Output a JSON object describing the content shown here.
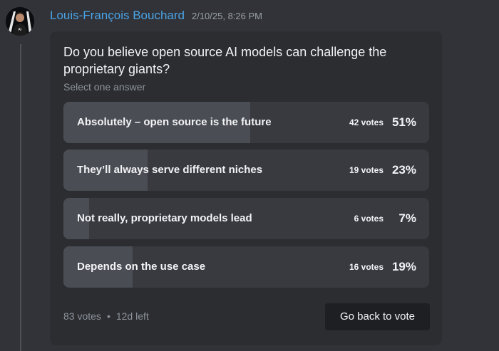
{
  "message": {
    "author": "Louis-François Bouchard",
    "timestamp": "2/10/25, 8:26 PM"
  },
  "poll": {
    "question": "Do you believe open source AI models can challenge the proprietary giants?",
    "hint": "Select one answer",
    "options": [
      {
        "label": "Absolutely – open source is the future",
        "votes": "42 votes",
        "percent": "51%",
        "fraction": 0.51
      },
      {
        "label": "They’ll always serve different niches",
        "votes": "19 votes",
        "percent": "23%",
        "fraction": 0.23
      },
      {
        "label": "Not really, proprietary models lead",
        "votes": "6 votes",
        "percent": "7%",
        "fraction": 0.07
      },
      {
        "label": "Depends on the use case",
        "votes": "16 votes",
        "percent": "19%",
        "fraction": 0.19
      }
    ],
    "total_votes": "83 votes",
    "separator": "•",
    "time_left": "12d left",
    "back_button": "Go back to vote"
  },
  "colors": {
    "background": "#313338",
    "card": "#2b2d31",
    "option_bg": "#383a40",
    "option_fill": "#4b4d55",
    "author": "#4aa3e6"
  }
}
